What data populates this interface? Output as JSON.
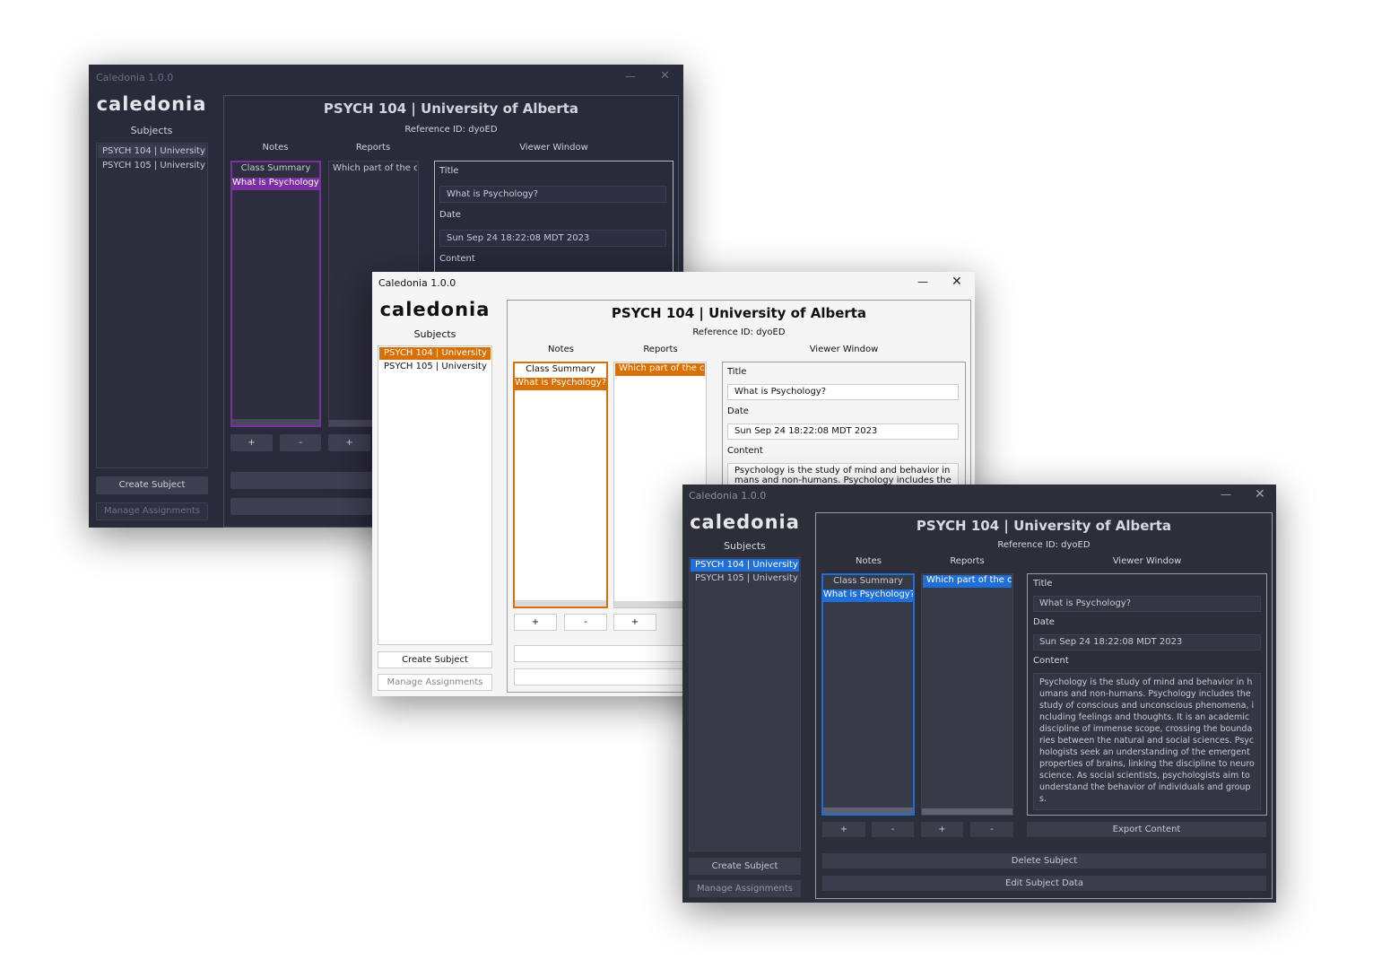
{
  "app": {
    "window_title": "Caledonia 1.0.0",
    "logo": "caledonia",
    "subjects_label": "Subjects",
    "subjects": [
      "PSYCH 104 | University ...",
      "PSYCH 105 | University ..."
    ],
    "create_subject": "Create Subject",
    "manage_assignments": "Manage Assignments",
    "subject_title": "PSYCH 104 | University of Alberta",
    "reference_id": "Reference ID: dyoED",
    "notes_label": "Notes",
    "reports_label": "Reports",
    "viewer_label": "Viewer Window",
    "notes": [
      "Class Summary",
      "What is Psychology?"
    ],
    "reports": [
      "Which part of the cl..."
    ],
    "title_label": "Title",
    "title_value": "What is Psychology?",
    "date_label": "Date",
    "date_value": "Sun Sep 24 18:22:08 MDT 2023",
    "content_label": "Content",
    "content_value": "Psychology is the study of mind and behavior in humans and non-humans. Psychology includes the study of conscious and unconscious phenomena, including feelings and thoughts. It is an academic discipline of immense scope, crossing the boundaries between the natural and social sciences. Psychologists seek an understanding of the emergent properties of brains, linking the discipline to neuroscience. As social scientists, psychologists aim to understand the behavior of individuals and groups.",
    "content_preview_light": "Psychology is the study of mind and behavior in hu",
    "content_preview_light_2": "mans and non-humans. Psychology includes the stu",
    "plus": "+",
    "minus": "-",
    "export_content": "Export Content",
    "delete_subject": "Delete Subject",
    "edit_subject_data": "Edit Subject Data",
    "minimize_glyph": "—",
    "close_glyph": "✕"
  },
  "themes": {
    "purple_accent": "#7b2fa3",
    "orange_accent": "#d96f05",
    "blue_accent": "#1e6fd9"
  }
}
